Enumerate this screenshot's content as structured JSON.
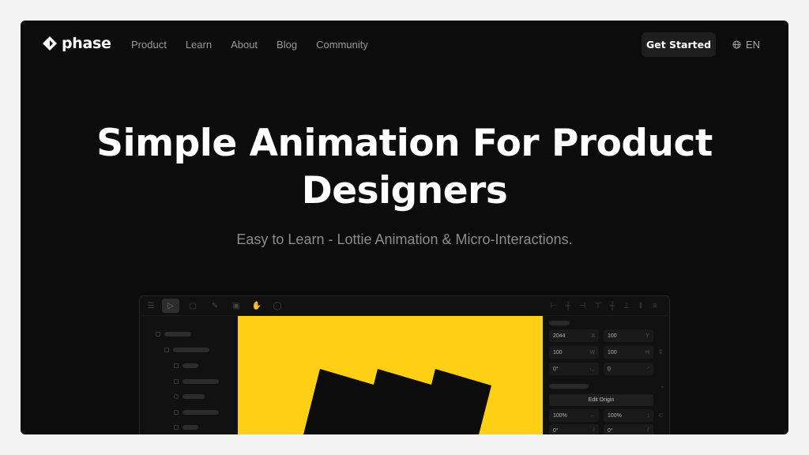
{
  "brand": {
    "name": "phase"
  },
  "nav": {
    "links": [
      "Product",
      "Learn",
      "About",
      "Blog",
      "Community"
    ],
    "cta_label": "Get Started",
    "language": "EN"
  },
  "hero": {
    "title_line1": "Simple Animation For Product",
    "title_line2": "Designers",
    "subtitle": "Easy to Learn - Lottie Animation & Micro-Interactions."
  },
  "app_preview": {
    "tools": [
      "menu-icon",
      "select-icon",
      "rectangle-icon",
      "pen-icon",
      "image-icon",
      "hand-icon",
      "comment-icon"
    ],
    "align_tools": [
      "align-left-icon",
      "align-center-h-icon",
      "align-right-icon",
      "align-top-icon",
      "align-center-v-icon",
      "align-bottom-icon",
      "distribute-h-icon",
      "distribute-v-icon"
    ],
    "canvas_color": "#fdd015",
    "properties": {
      "x": "2044",
      "x_label": "X",
      "y": "100",
      "y_label": "Y",
      "w": "100",
      "w_label": "W",
      "h": "100",
      "h_label": "H",
      "rotation": "0°",
      "radius": "0",
      "edit_origin_label": "Edit Origin",
      "scale_x": "100%",
      "scale_y": "100%",
      "skew_x": "0°",
      "skew_y": "0°"
    }
  },
  "colors": {
    "background": "#0c0c0c",
    "accent": "#fdd015",
    "page": "#f4f4f4"
  }
}
